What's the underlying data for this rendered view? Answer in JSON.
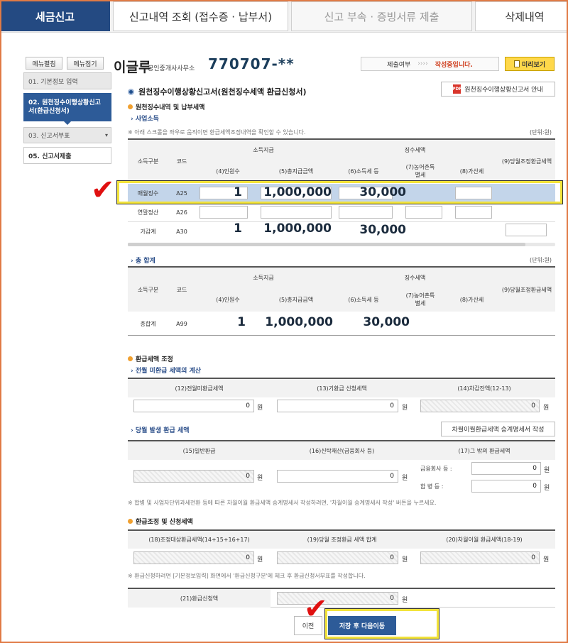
{
  "tabs": [
    {
      "label": "세금신고"
    },
    {
      "label": "신고내역 조회 (접수증 · 납부서)"
    },
    {
      "label": "신고 부속 · 증빙서류 제출"
    },
    {
      "label": "삭제내역"
    }
  ],
  "sidebar": {
    "expand_label": "메뉴펼침",
    "collapse_label": "메뉴접기",
    "steps": [
      {
        "label": "01. 기본정보 입력"
      },
      {
        "label": "02. 원천징수이행상황신고서(환급신청서)"
      },
      {
        "label": "03. 신고서부표"
      },
      {
        "label": "05. 신고서제출"
      }
    ]
  },
  "header": {
    "name": "이글루",
    "office": "공인중개사사무소",
    "ssn": "770707-**",
    "status_label": "제출여부",
    "status_arrows": "››››",
    "status_value": "작성중입니다.",
    "preview_label": "미리보기"
  },
  "form": {
    "title": "원천징수이행상황신고서(원천징수세액 환급신청서)",
    "guide_label": "원천징수이행상황신고서 안내",
    "pdf_icon_text": "PDF"
  },
  "section1": {
    "title": "원천징수내역 및 납부세액",
    "subtitle": "사업소득",
    "note": "※ 아래 스크롤을 좌우로 움직이면 환급세액조정내역을 확인할 수 있습니다.",
    "unit": "(단위:원)",
    "headers": {
      "type": "소득구분",
      "code": "코드",
      "income_group": "소득지급",
      "tax_group": "징수세액",
      "c4": "(4)인원수",
      "c5": "(5)총지급금액",
      "c6": "(6)소득세 등",
      "c7": "(7)농어촌특별세",
      "c8": "(8)가산세",
      "c9": "(9)당월조정환급세액"
    },
    "rows": [
      {
        "type": "매월징수",
        "code": "A25",
        "count": "1",
        "amount": "1,000,000",
        "tax": "30,000"
      },
      {
        "type": "연말정산",
        "code": "A26",
        "count": "",
        "amount": "",
        "tax": ""
      },
      {
        "type": "가감계",
        "code": "A30",
        "count": "1",
        "amount": "1,000,000",
        "tax": "30,000"
      }
    ]
  },
  "section2": {
    "subtitle": "총 합계",
    "unit": "(단위:원)",
    "row": {
      "type": "총합계",
      "code": "A99",
      "count": "1",
      "amount": "1,000,000",
      "tax": "30,000"
    }
  },
  "refund": {
    "title": "환급세액 조정",
    "prev_sub": "전월 미환급 세액의 계산",
    "c12": "(12)전월미환급세액",
    "c13": "(13)기환급 신청세액",
    "c14": "(14)차감잔액(12-13)",
    "cur_sub": "당월 발생 환급 세액",
    "carry_btn": "차월이월환급세액 승계명세서 작성",
    "c15": "(15)일반환급",
    "c16": "(16)신탁재산(금융회사 등)",
    "c17": "(17)그 밖의 환급세액",
    "fin_label": "금융회사 등 :",
    "merge_label": "합 병 등 :",
    "note": "※ 합병 및 사업자단위과세전환 등에 따른 차월이월 환급세액 승계명세서 작성하려면, '차월이월 승계명세서 작성' 버튼을 누르세요.",
    "zero": "0",
    "won": "원"
  },
  "adjust": {
    "title": "환급조정 및 신청세액",
    "c18": "(18)조정대상환급세액(14+15+16+17)",
    "c19": "(19)당월 조정환급 세액 합계",
    "c20": "(20)차월이월 환급세액(18-19)",
    "note": "※ 환급신청하려면 [기본정보입력] 화면에서 '환급신청구분'에 체크 후 환급신청서부표를 작성합니다.",
    "c21": "(21)환급신청액"
  },
  "actions": {
    "prev_label": "이전",
    "next_label": "저장 후 다음이동"
  },
  "annotations": {
    "check_mark": "✔"
  }
}
